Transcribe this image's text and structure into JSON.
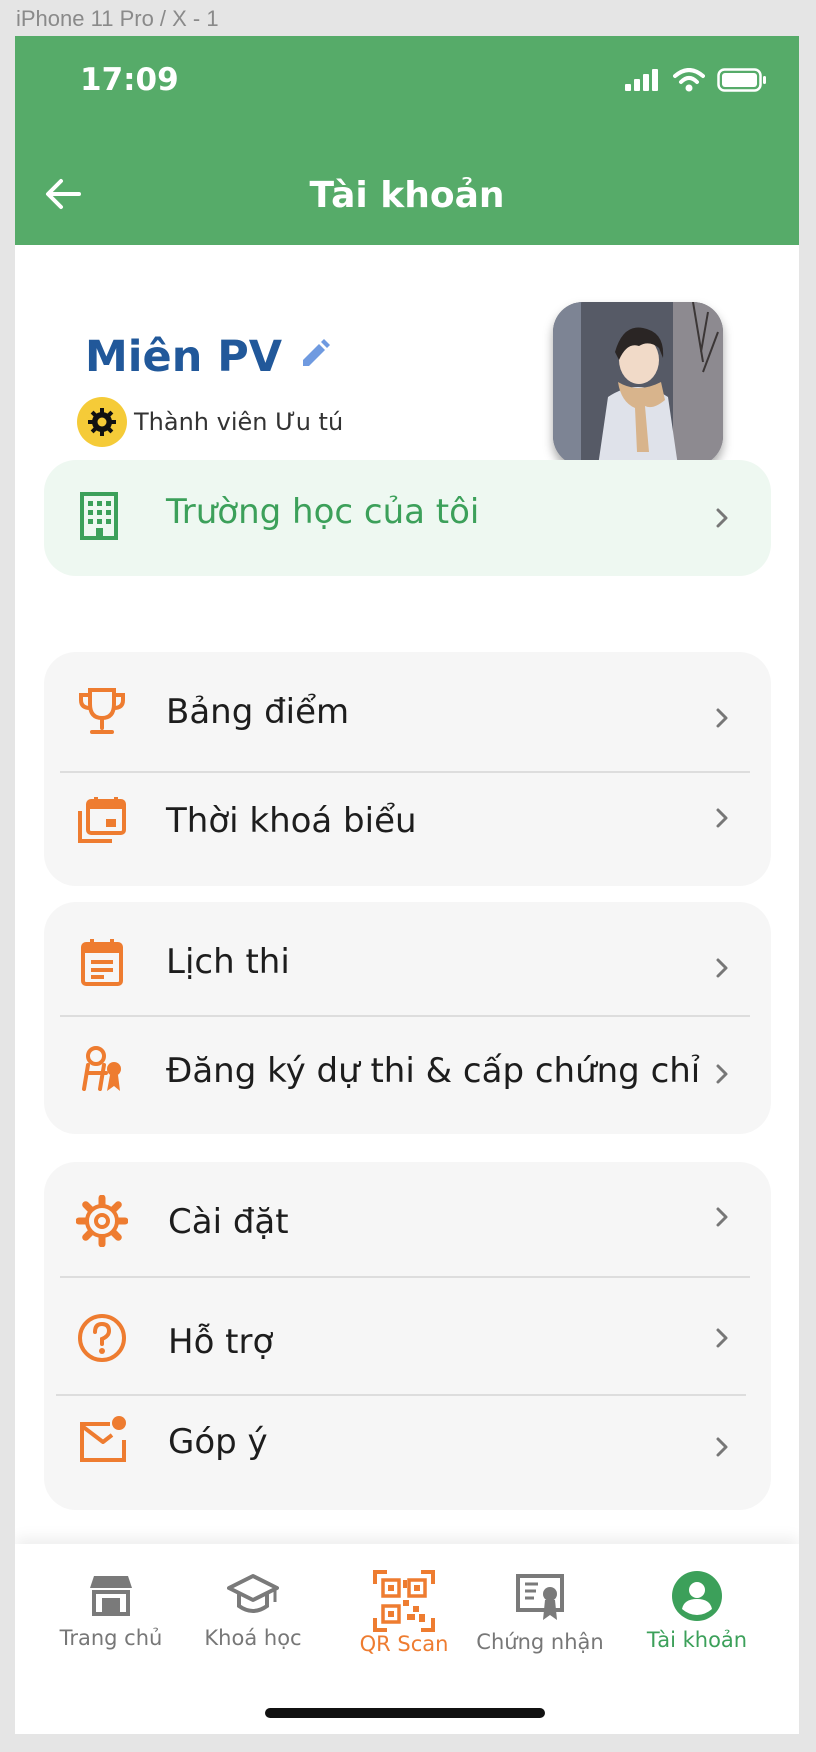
{
  "artboard_label": "iPhone 11 Pro / X - 1",
  "status_bar": {
    "time": "17:09"
  },
  "header": {
    "title": "Tài khoản"
  },
  "profile": {
    "name": "Miên PV",
    "membership": "Thành viên Ưu tú"
  },
  "school": {
    "label": "Trường học của tôi"
  },
  "groups": [
    {
      "items": [
        {
          "label": "Bảng điểm",
          "icon": "trophy-icon"
        },
        {
          "label": "Thời khoá biểu",
          "icon": "schedule-icon"
        }
      ]
    },
    {
      "items": [
        {
          "label": "Lịch thi",
          "icon": "exam-calendar-icon"
        },
        {
          "label": "Đăng ký dự thi & cấp chứng chỉ",
          "icon": "register-certificate-icon"
        }
      ]
    },
    {
      "items": [
        {
          "label": "Cài đặt",
          "icon": "gear-icon"
        },
        {
          "label": "Hỗ trợ",
          "icon": "help-icon"
        },
        {
          "label": "Góp ý",
          "icon": "mail-icon"
        }
      ]
    }
  ],
  "bottom_nav": [
    {
      "label": "Trang chủ",
      "icon": "store-icon"
    },
    {
      "label": "Khoá học",
      "icon": "graduation-cap-icon"
    },
    {
      "label": "QR Scan",
      "icon": "qr-icon"
    },
    {
      "label": "Chứng nhận",
      "icon": "certificate-icon"
    },
    {
      "label": "Tài khoản",
      "icon": "account-icon"
    }
  ],
  "colors": {
    "header_green": "#56ab69",
    "accent_orange": "#ee7c30",
    "name_blue": "#21589a",
    "active_green": "#3ca05a"
  }
}
